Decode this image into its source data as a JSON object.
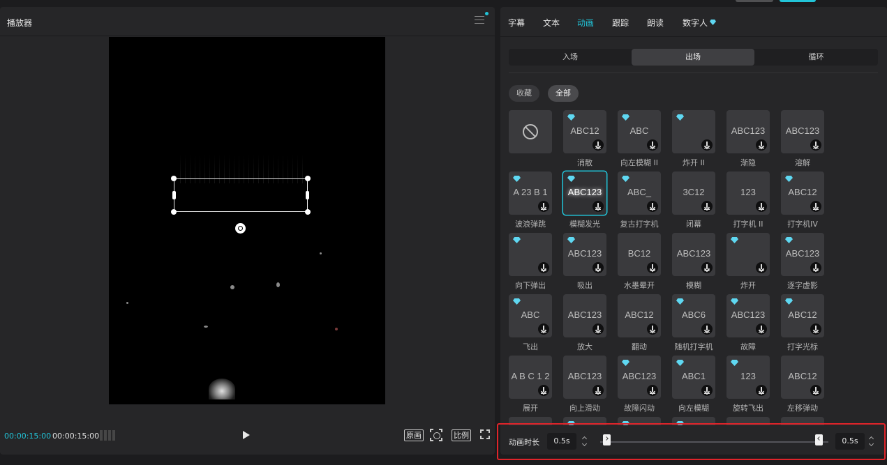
{
  "player": {
    "title": "播放器",
    "time_current": "00:00:15:00",
    "time_total": "00:00:15:00",
    "btn_original": "原画",
    "btn_ratio": "比例"
  },
  "tabs": [
    {
      "label": "字幕",
      "active": false
    },
    {
      "label": "文本",
      "active": false
    },
    {
      "label": "动画",
      "active": true
    },
    {
      "label": "跟踪",
      "active": false
    },
    {
      "label": "朗读",
      "active": false
    },
    {
      "label": "数字人",
      "active": false,
      "vip": true
    }
  ],
  "segments": [
    {
      "label": "入场",
      "active": false
    },
    {
      "label": "出场",
      "active": true
    },
    {
      "label": "循环",
      "active": false
    }
  ],
  "filters": [
    {
      "label": "收藏",
      "active": false
    },
    {
      "label": "全部",
      "active": true
    }
  ],
  "effects": [
    {
      "name": "",
      "preview": "",
      "vip": false,
      "none": true
    },
    {
      "name": "消散",
      "preview": "ABC12",
      "vip": true
    },
    {
      "name": "向左模糊 II",
      "preview": "ABC",
      "vip": true
    },
    {
      "name": "炸开 II",
      "preview": "",
      "vip": true
    },
    {
      "name": "渐隐",
      "preview": "ABC123",
      "vip": false
    },
    {
      "name": "溶解",
      "preview": "ABC123",
      "vip": false
    },
    {
      "name": "波浪弹跳",
      "preview": "A 23 B 1",
      "vip": true
    },
    {
      "name": "模糊发光",
      "preview": "ABC123",
      "vip": true,
      "selected": true
    },
    {
      "name": "复古打字机",
      "preview": "ABC_",
      "vip": true
    },
    {
      "name": "闭幕",
      "preview": "3C12",
      "vip": false
    },
    {
      "name": "打字机 II",
      "preview": "123",
      "vip": false
    },
    {
      "name": "打字机IV",
      "preview": "ABC12",
      "vip": true
    },
    {
      "name": "向下弹出",
      "preview": "",
      "vip": true
    },
    {
      "name": "吸出",
      "preview": "ABC123",
      "vip": true
    },
    {
      "name": "水墨晕开",
      "preview": "BC12",
      "vip": false
    },
    {
      "name": "模糊",
      "preview": "ABC123",
      "vip": false
    },
    {
      "name": "炸开",
      "preview": "",
      "vip": true
    },
    {
      "name": "逐字虚影",
      "preview": "ABC123",
      "vip": true
    },
    {
      "name": "飞出",
      "preview": "ABC",
      "vip": true
    },
    {
      "name": "放大",
      "preview": "ABC123",
      "vip": false
    },
    {
      "name": "翻动",
      "preview": "ABC12",
      "vip": false
    },
    {
      "name": "随机打字机",
      "preview": "ABC6",
      "vip": true
    },
    {
      "name": "故障",
      "preview": "ABC123",
      "vip": true
    },
    {
      "name": "打字光标",
      "preview": "ABC12",
      "vip": true
    },
    {
      "name": "展开",
      "preview": "A B C 1 2",
      "vip": false
    },
    {
      "name": "向上滑动",
      "preview": "ABC123",
      "vip": false
    },
    {
      "name": "故障闪动",
      "preview": "ABC123",
      "vip": true
    },
    {
      "name": "向左模糊",
      "preview": "ABC1",
      "vip": true
    },
    {
      "name": "旋转飞出",
      "preview": "123",
      "vip": true
    },
    {
      "name": "左移弹动",
      "preview": "ABC12",
      "vip": false
    },
    {
      "name": "",
      "preview": "",
      "vip": false
    },
    {
      "name": "",
      "preview": "",
      "vip": true
    },
    {
      "name": "",
      "preview": "",
      "vip": true
    },
    {
      "name": "",
      "preview": "",
      "vip": true
    },
    {
      "name": "",
      "preview": "",
      "vip": false
    },
    {
      "name": "",
      "preview": "",
      "vip": false
    }
  ],
  "duration": {
    "label": "动画时长",
    "value_left": "0.5s",
    "value_right": "0.5s"
  },
  "colors": {
    "accent": "#22c4d8",
    "vip": "#5fd8f2",
    "highlight": "#e0242a"
  }
}
